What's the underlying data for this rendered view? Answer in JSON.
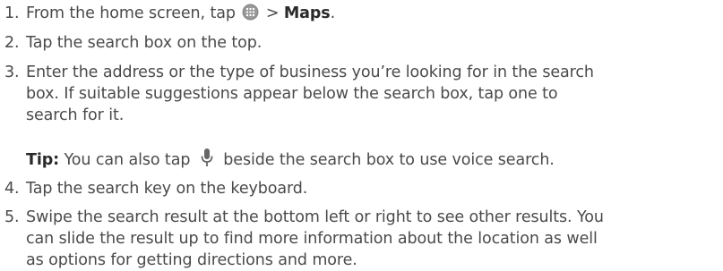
{
  "steps": [
    {
      "number": "1.",
      "before_icon": "From the home screen, tap",
      "icon": "apps-grid-icon",
      "after_icon": "> ",
      "bold": "Maps",
      "end": "."
    },
    {
      "number": "2.",
      "text": "Tap the search box on the top."
    },
    {
      "number": "3.",
      "lines": [
        "Enter the address or the type of business you’re looking for in the search",
        "box. If suitable suggestions appear below the search box, tap one to",
        "search for it."
      ]
    },
    {
      "number": "4.",
      "text": "Tap the search key on the keyboard."
    },
    {
      "number": "5.",
      "lines": [
        "Swipe the search result at the bottom left or right to see other results. You",
        "can slide the result up to find more information about the location as well",
        "as options for getting directions and more."
      ]
    }
  ],
  "tip": {
    "label": "Tip:",
    "before_icon": "You can also tap",
    "icon": "microphone-icon",
    "after_icon": "beside the search box to use voice search."
  }
}
